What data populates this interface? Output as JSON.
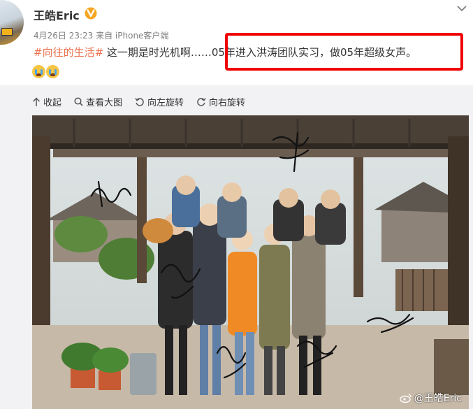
{
  "post": {
    "username": "王皓Eric",
    "meta": "4月26日 23:23 来自 iPhone客户端",
    "hashtag": "#向往的生活#",
    "text": " 这一期是时光机啊……05年进入洪涛团队实习，做05年超级女声。"
  },
  "toolbar": {
    "collapse_label": "收起",
    "view_large_label": "查看大图",
    "rotate_left_label": "向左旋转",
    "rotate_right_label": "向右旋转"
  },
  "photo": {
    "watermark": "@王皓Eric"
  },
  "colors": {
    "hashtag": "#eb7350",
    "highlight_box": "#f00000",
    "verified": "#f6a623"
  }
}
